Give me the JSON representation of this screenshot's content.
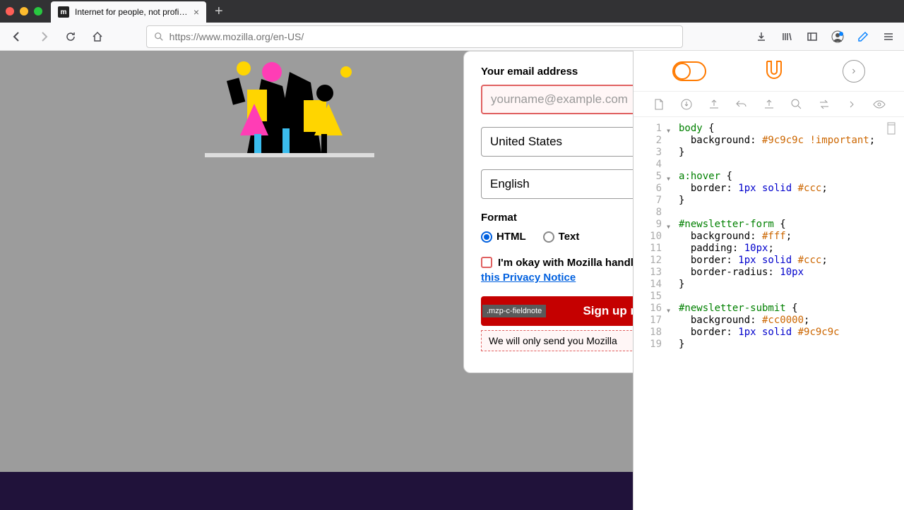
{
  "chrome": {
    "tab_title": "Internet for people, not profit —",
    "tab_favicon": "m",
    "new_tab": "+",
    "close": "×",
    "url": "https://www.mozilla.org/en-US/"
  },
  "form": {
    "email_label": "Your email address",
    "email_placeholder": "yourname@example.com",
    "country": "United States",
    "language": "English",
    "format_label": "Format",
    "format_html": "HTML",
    "format_text": "Text",
    "consent_text": "I'm okay with Mozilla handling",
    "privacy_link": "this Privacy Notice",
    "signup_label": "Sign up now",
    "css_badge": ".mzp-c-fieldnote",
    "fieldnote": "We will only send you Mozilla"
  },
  "devtools": {
    "expand": "›",
    "lines": [
      "1",
      "2",
      "3",
      "4",
      "5",
      "6",
      "7",
      "8",
      "9",
      "10",
      "11",
      "12",
      "13",
      "14",
      "15",
      "16",
      "17",
      "18",
      "19"
    ]
  },
  "css": {
    "l1_sel": "body",
    "l1_brace": " {",
    "l2_prop": "  background:",
    "l2_val": " #9c9c9c",
    "l2_imp": " !important",
    "l2_end": ";",
    "l3": "}",
    "l5_sel": "a",
    "l5_pseudo": ":hover",
    "l5_brace": " {",
    "l6_prop": "  border:",
    "l6_val": " 1px solid",
    "l6_col": " #ccc",
    "l6_end": ";",
    "l7": "}",
    "l9_sel": "#newsletter-form",
    "l9_brace": " {",
    "l10_prop": "  background:",
    "l10_val": " #fff",
    "l10_end": ";",
    "l11_prop": "  padding:",
    "l11_val": " 10px",
    "l11_end": ";",
    "l12_prop": "  border:",
    "l12_val": " 1px solid",
    "l12_col": " #ccc",
    "l12_end": ";",
    "l13_prop": "  border-radius:",
    "l13_val": " 10px",
    "l14": "}",
    "l16_sel": "#newsletter-submit",
    "l16_brace": " {",
    "l17_prop": "  background:",
    "l17_val": " #cc0000",
    "l17_end": ";",
    "l18_prop": "  border:",
    "l18_val": " 1px solid",
    "l18_col": " #9c9c9c",
    "l19": "}"
  }
}
